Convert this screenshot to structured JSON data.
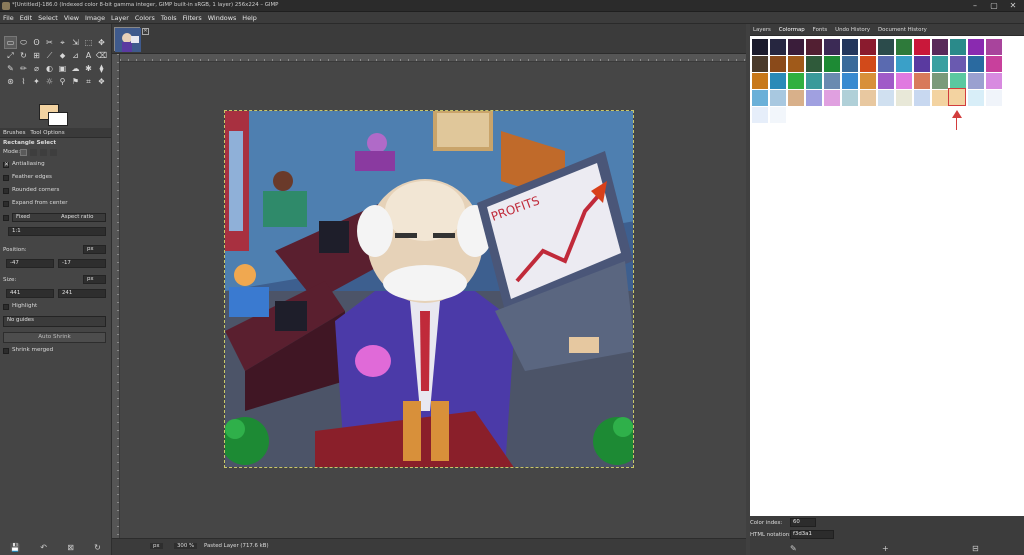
{
  "window": {
    "title": "*[Untitled]-186.0 (Indexed color 8-bit gamma integer, GIMP built-in sRGB, 1 layer) 256x224 – GIMP",
    "controls": [
      "–",
      "▢",
      "✕"
    ]
  },
  "menu": [
    "File",
    "Edit",
    "Select",
    "View",
    "Image",
    "Layer",
    "Colors",
    "Tools",
    "Filters",
    "Windows",
    "Help"
  ],
  "toolbox": {
    "tools": [
      "▭",
      "⬭",
      "ʘ",
      "✂",
      "⌖",
      "⇲",
      "⬚",
      "✥",
      "⤢",
      "↻",
      "⊞",
      "⟋",
      "⬥",
      "⊿",
      "A",
      "⌫",
      "✎",
      "✏",
      "⌀",
      "◐",
      "▣",
      "☁",
      "✱",
      "⧫",
      "⊛",
      "⌇",
      "✦",
      "☼",
      "⚲",
      "⚑",
      "⌗",
      "❖"
    ],
    "fg_color": "#f3d3a1",
    "bg_color": "#ffffff",
    "tabs": [
      "Brushes",
      "Tool Options"
    ],
    "options": {
      "title": "Rectangle Select",
      "mode_label": "Mode:",
      "antialiasing": "Antialiasing",
      "feather": "Feather edges",
      "rounded": "Rounded corners",
      "expand": "Expand from center",
      "fixed": "Fixed",
      "aspect": "Aspect ratio",
      "ratio": "1:1",
      "position_label": "Position:",
      "pos_unit": "px",
      "pos_x": "-47",
      "pos_y": "-17",
      "size_label": "Size:",
      "size_unit": "px",
      "size_w": "441",
      "size_h": "241",
      "highlight": "Highlight",
      "guides": "No guides",
      "auto_shrink": "Auto Shrink",
      "shrink_merged": "Shrink merged"
    },
    "bottom_icons": [
      "💾",
      "↶",
      "⊠",
      "↻"
    ]
  },
  "statusbar": {
    "unit": "px",
    "zoom": "300 %",
    "layer": "Pasted Layer (717.6 kB)"
  },
  "dock": {
    "tabs": [
      "Layers",
      "Colormap",
      "Fonts",
      "Undo History",
      "Document History"
    ],
    "colormap": [
      "#1b1b2b",
      "#262640",
      "#3a1d3a",
      "#521f32",
      "#3b2a55",
      "#23365c",
      "#8a1b2e",
      "#2b4b4b",
      "#2e7a3a",
      "#c9183a",
      "#5a2a5a",
      "#2a8a8a",
      "#8a2ab0",
      "#a8449c",
      "#4a3a2a",
      "#8a4a1a",
      "#a05a1a",
      "#2f5a3a",
      "#1d8a34",
      "#3a6a9a",
      "#d24a1a",
      "#5a6ab0",
      "#3aa0c8",
      "#5a3aa0",
      "#3aa0a0",
      "#6a5ab0",
      "#2a6aa0",
      "#c8409c",
      "#c8781a",
      "#2a8ab8",
      "#30b040",
      "#3a9a9a",
      "#6a8ab0",
      "#3a8ad0",
      "#d8903a",
      "#a05ac8",
      "#e07ae0",
      "#d87a5a",
      "#7a9a7a",
      "#5ac8a0",
      "#9aa0d0",
      "#d88ae0",
      "#6ab0d8",
      "#a8c8e0",
      "#d8b08a",
      "#a0a0e0",
      "#e0a0e0",
      "#b0d0d8",
      "#e8c8a0",
      "#d0e0f0",
      "#e8e8d8",
      "#c8d8f0",
      "#f3d3a1",
      "#e0e8f8",
      "#d8eef8",
      "#f0f4fa",
      "#e6eefa",
      "#f2f6fb"
    ],
    "color_index_label": "Color index:",
    "color_index": "60",
    "html_label": "HTML notation:",
    "html_value": "f3d3a1",
    "bottom_icons": [
      "✎",
      "+",
      "⊟"
    ]
  }
}
